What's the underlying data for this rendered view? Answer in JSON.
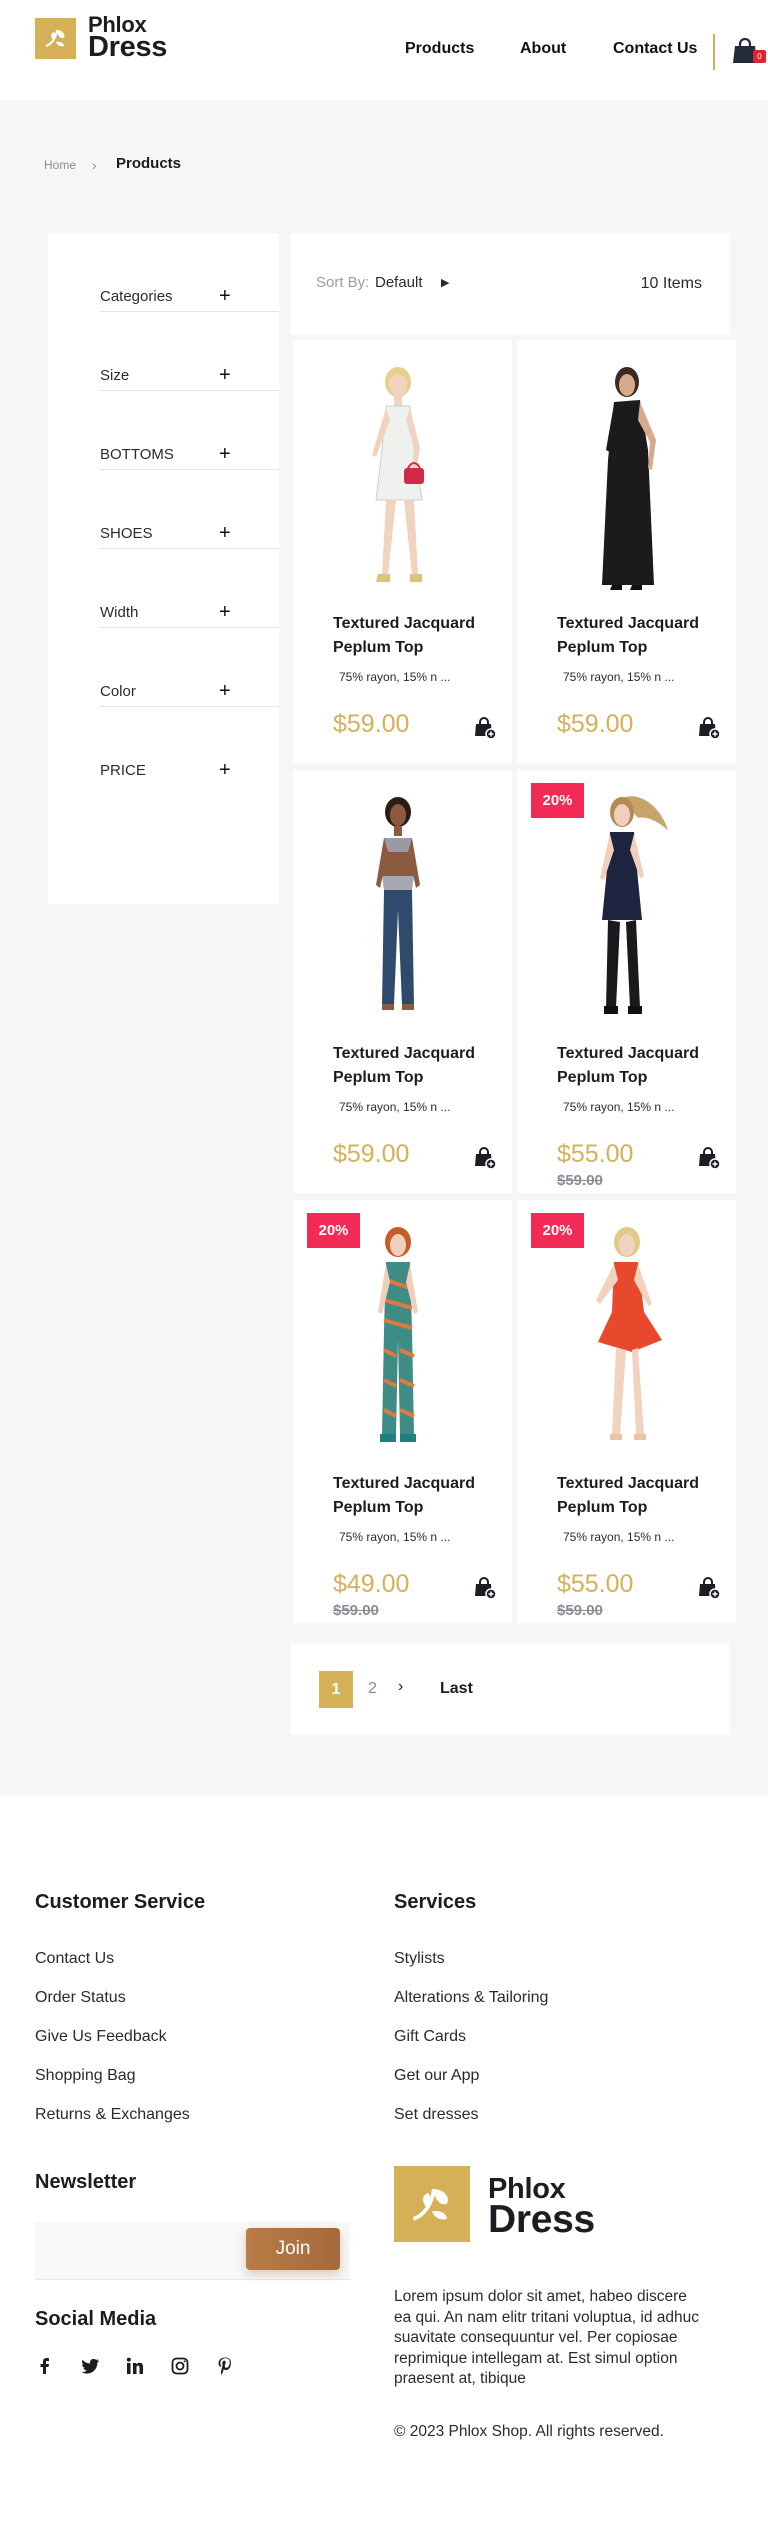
{
  "brand": {
    "line1": "Phlox",
    "line2": "Dress",
    "accent": "#d6b056"
  },
  "nav": {
    "items": [
      "Products",
      "About",
      "Contact Us"
    ],
    "cart_count": "0"
  },
  "breadcrumb": {
    "home": "Home",
    "current": "Products"
  },
  "filters": [
    "Categories",
    "Size",
    "BOTTOMS",
    "SHOES",
    "Width",
    "Color",
    "PRICE"
  ],
  "sort": {
    "label": "Sort By:",
    "value": "Default",
    "items_count": "10 Items"
  },
  "products": [
    {
      "title": "Textured Jacquard Peplum Top",
      "desc": "75% rayon, 15% n ...",
      "price": "$59.00",
      "old_price": "",
      "badge": "",
      "outfit": "white-dress"
    },
    {
      "title": "Textured Jacquard Peplum Top",
      "desc": "75% rayon, 15% n ...",
      "price": "$59.00",
      "old_price": "",
      "badge": "",
      "outfit": "black-gown"
    },
    {
      "title": "Textured Jacquard Peplum Top",
      "desc": "75% rayon, 15% n ...",
      "price": "$59.00",
      "old_price": "",
      "badge": "",
      "outfit": "jeans-top"
    },
    {
      "title": "Textured Jacquard Peplum Top",
      "desc": "75% rayon, 15% n ...",
      "price": "$55.00",
      "old_price": "$59.00",
      "badge": "20%",
      "outfit": "navy-dress"
    },
    {
      "title": "Textured Jacquard Peplum Top",
      "desc": "75% rayon, 15% n ...",
      "price": "$49.00",
      "old_price": "$59.00",
      "badge": "20%",
      "outfit": "patterned-jumpsuit"
    },
    {
      "title": "Textured Jacquard Peplum Top",
      "desc": "75% rayon, 15% n ...",
      "price": "$55.00",
      "old_price": "$59.00",
      "badge": "20%",
      "outfit": "red-dress"
    }
  ],
  "pagination": {
    "current": "1",
    "next_page": "2",
    "last": "Last"
  },
  "footer": {
    "customer_service": {
      "heading": "Customer Service",
      "links": [
        "Contact Us",
        "Order Status",
        "Give Us Feedback",
        "Shopping Bag",
        "Returns & Exchanges"
      ]
    },
    "services": {
      "heading": "Services",
      "links": [
        "Stylists",
        "Alterations & Tailoring",
        "Gift Cards",
        "Get our App",
        "Set dresses"
      ]
    },
    "newsletter": {
      "heading": "Newsletter",
      "join": "Join"
    },
    "social": {
      "heading": "Social Media",
      "icons": [
        "facebook-icon",
        "twitter-icon",
        "linkedin-icon",
        "instagram-icon",
        "pinterest-icon"
      ]
    },
    "about": "Lorem ipsum dolor sit amet, habeo discere ea qui. An nam elitr tritani voluptua, id adhuc suavitate consequuntur vel. Per copiosae reprimique intellegam at. Est simul option praesent at, tibique",
    "copyright": "© 2023 Phlox Shop. All rights reserved."
  }
}
